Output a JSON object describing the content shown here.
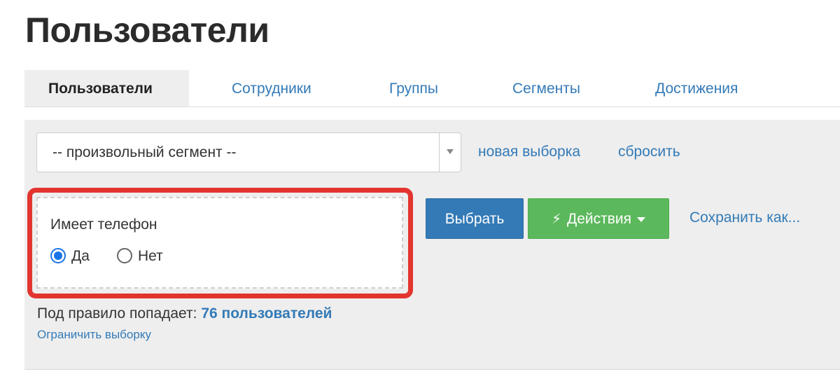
{
  "page": {
    "title": "Пользователи"
  },
  "tabs": [
    {
      "label": "Пользователи",
      "active": true
    },
    {
      "label": "Сотрудники",
      "active": false
    },
    {
      "label": "Группы",
      "active": false
    },
    {
      "label": "Сегменты",
      "active": false
    },
    {
      "label": "Достижения",
      "active": false
    }
  ],
  "filter": {
    "segment_select": {
      "value": "-- произвольный сегмент --"
    },
    "new_selection_link": "новая выборка",
    "reset_link": "сбросить"
  },
  "rule": {
    "title": "Имеет телефон",
    "options": [
      {
        "label": "Да",
        "checked": true
      },
      {
        "label": "Нет",
        "checked": false
      }
    ],
    "highlight_color": "#e3342f"
  },
  "actions": {
    "select_button": "Выбрать",
    "actions_button": "Действия",
    "actions_icon": "bolt-icon",
    "save_as_link": "Сохранить как..."
  },
  "result": {
    "prefix": "Под правило попадает:",
    "count_text": "76 пользователей",
    "limit_link": "Ограничить выборку"
  },
  "colors": {
    "link": "#337ab7",
    "primary": "#337ab7",
    "success": "#5cb85c",
    "panel_bg": "#eeeeee"
  }
}
